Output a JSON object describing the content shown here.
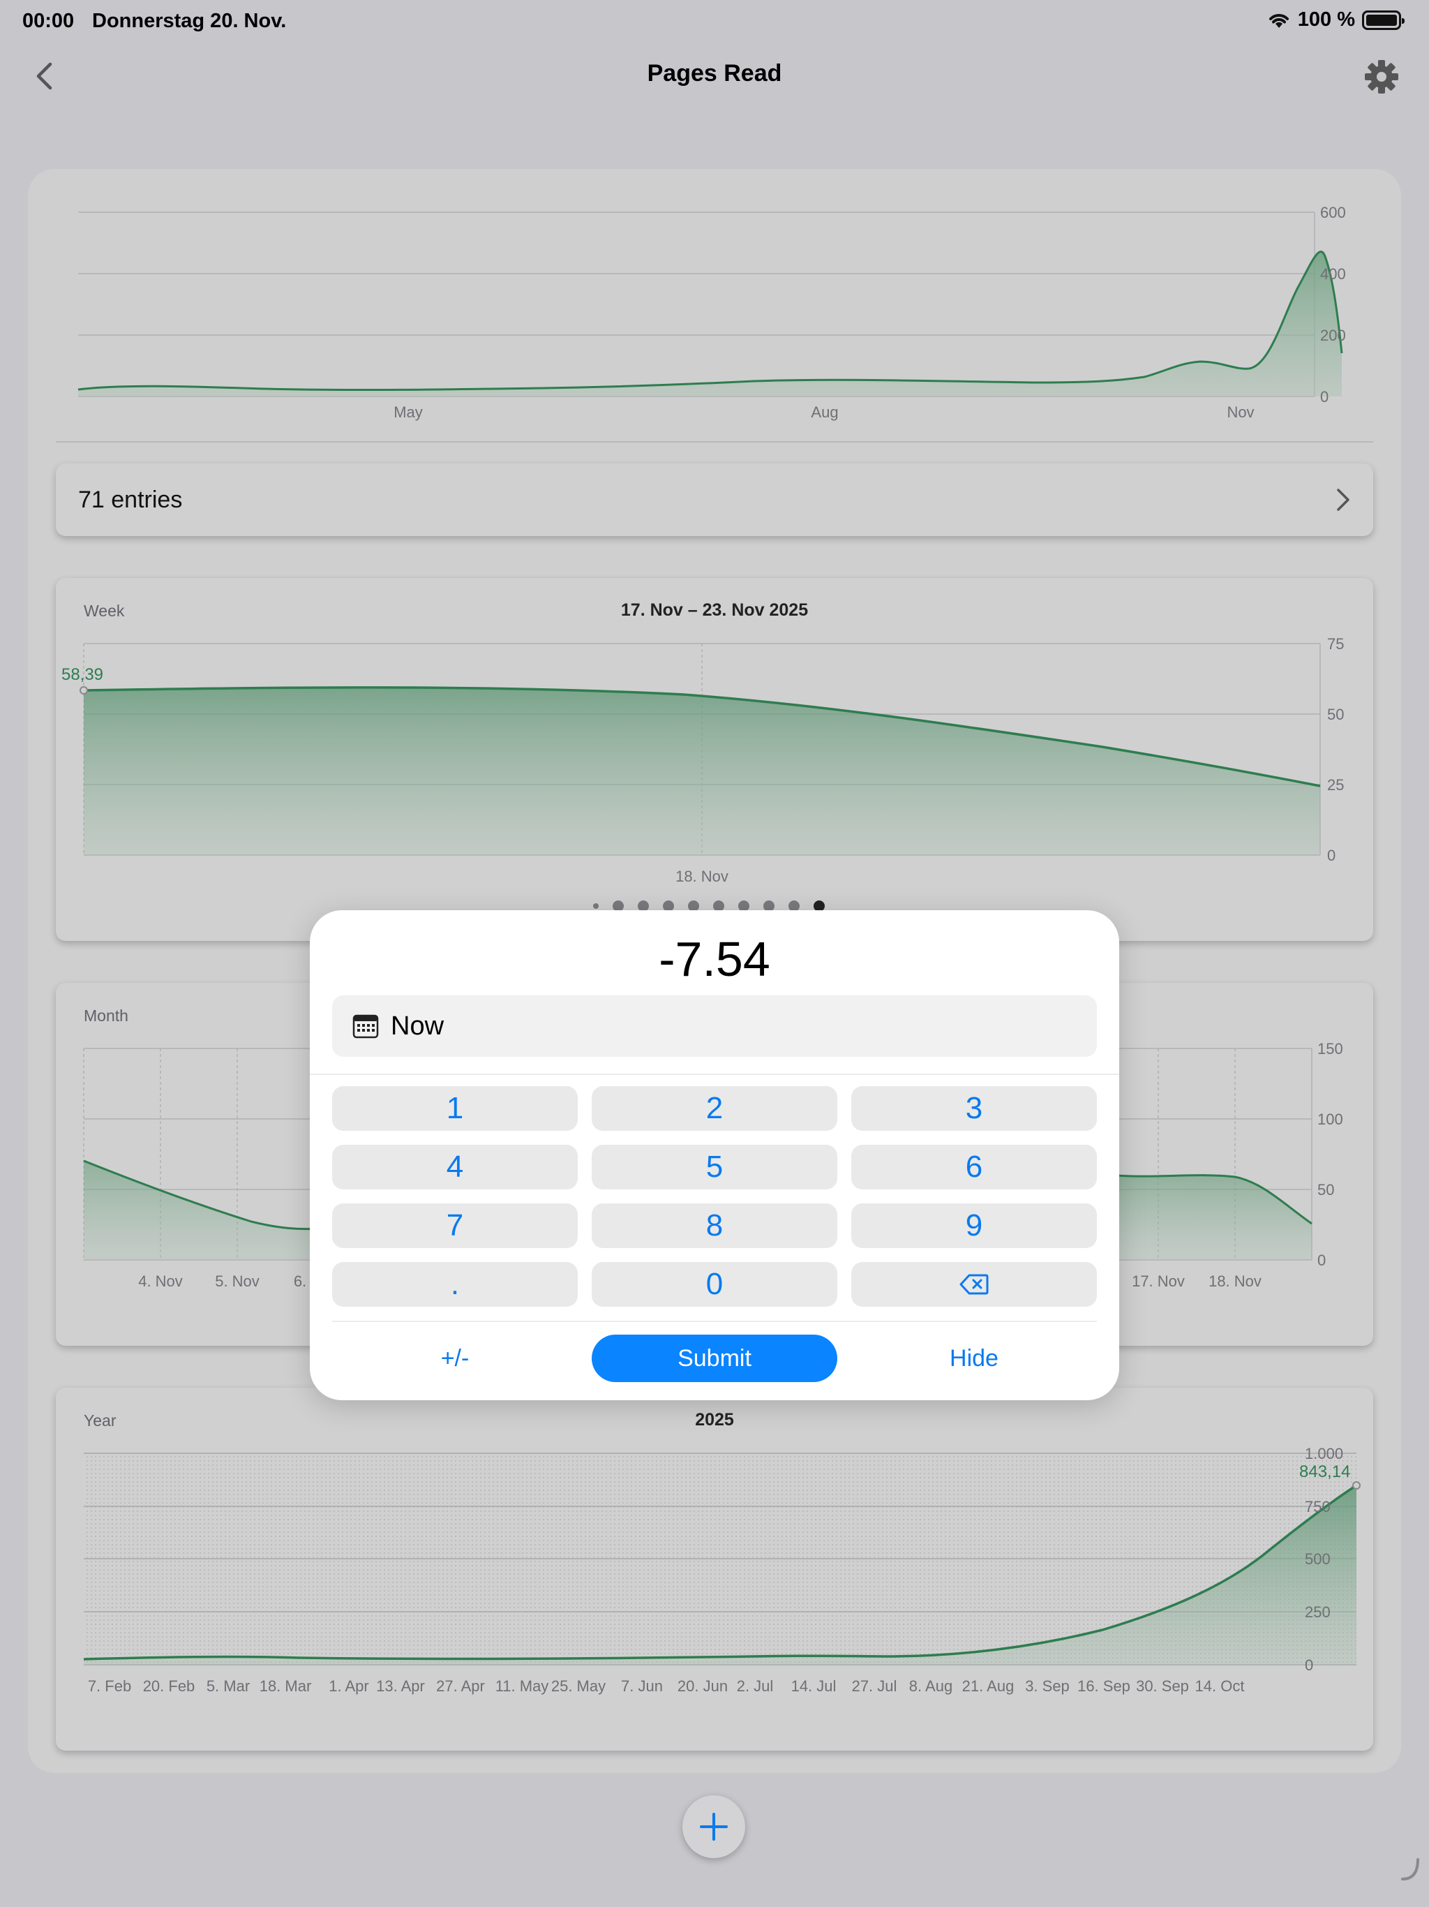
{
  "status_bar": {
    "time": "00:00",
    "date": "Donnerstag 20. Nov.",
    "battery": "100 %"
  },
  "nav": {
    "title": "Pages Read"
  },
  "overview_chart": {
    "y_ticks": [
      "600",
      "400",
      "200",
      "0"
    ],
    "x_ticks": [
      "May",
      "Aug",
      "Nov"
    ]
  },
  "entries": {
    "label": "71 entries"
  },
  "week_chart": {
    "period_label": "Week",
    "range_label": "17. Nov – 23. Nov 2025",
    "point_label": "58,39",
    "y_ticks": [
      "75",
      "50",
      "25",
      "0"
    ],
    "x_ticks": [
      "18. Nov"
    ]
  },
  "month_chart": {
    "period_label": "Month",
    "y_ticks": [
      "150",
      "100",
      "50",
      "0"
    ],
    "x_ticks_left": [
      "4. Nov",
      "5. Nov",
      "6."
    ],
    "x_ticks_right": [
      "17. Nov",
      "18. Nov"
    ]
  },
  "year_chart": {
    "period_label": "Year",
    "range_label": "2025",
    "point_label": "843,14",
    "y_ticks": [
      "1.000",
      "750",
      "500",
      "250",
      "0"
    ],
    "x_ticks": [
      "7. Feb",
      "20. Feb",
      "5. Mar",
      "18. Mar",
      "1. Apr",
      "13. Apr",
      "27. Apr",
      "11. May",
      "25. May",
      "7. Jun",
      "20. Jun",
      "2. Jul",
      "14. Jul",
      "27. Jul",
      "8. Aug",
      "21. Aug",
      "3. Sep",
      "16. Sep",
      "30. Sep",
      "14. Oct"
    ]
  },
  "pager": {
    "count": 10,
    "active": 9
  },
  "keypad": {
    "value": "-7.54",
    "date_label": "Now",
    "keys": [
      "1",
      "2",
      "3",
      "4",
      "5",
      "6",
      "7",
      "8",
      "9",
      ".",
      "0"
    ],
    "sign_label": "+/-",
    "submit_label": "Submit",
    "hide_label": "Hide"
  },
  "colors": {
    "accent": "#0a84ff",
    "line": "#2e7d4f",
    "fill": "#7fae8e"
  },
  "icons": [
    "chevron-left-icon",
    "gear-icon",
    "chevron-right-icon",
    "calendar-icon",
    "backspace-icon",
    "plus-icon",
    "wifi-icon",
    "battery-icon"
  ]
}
